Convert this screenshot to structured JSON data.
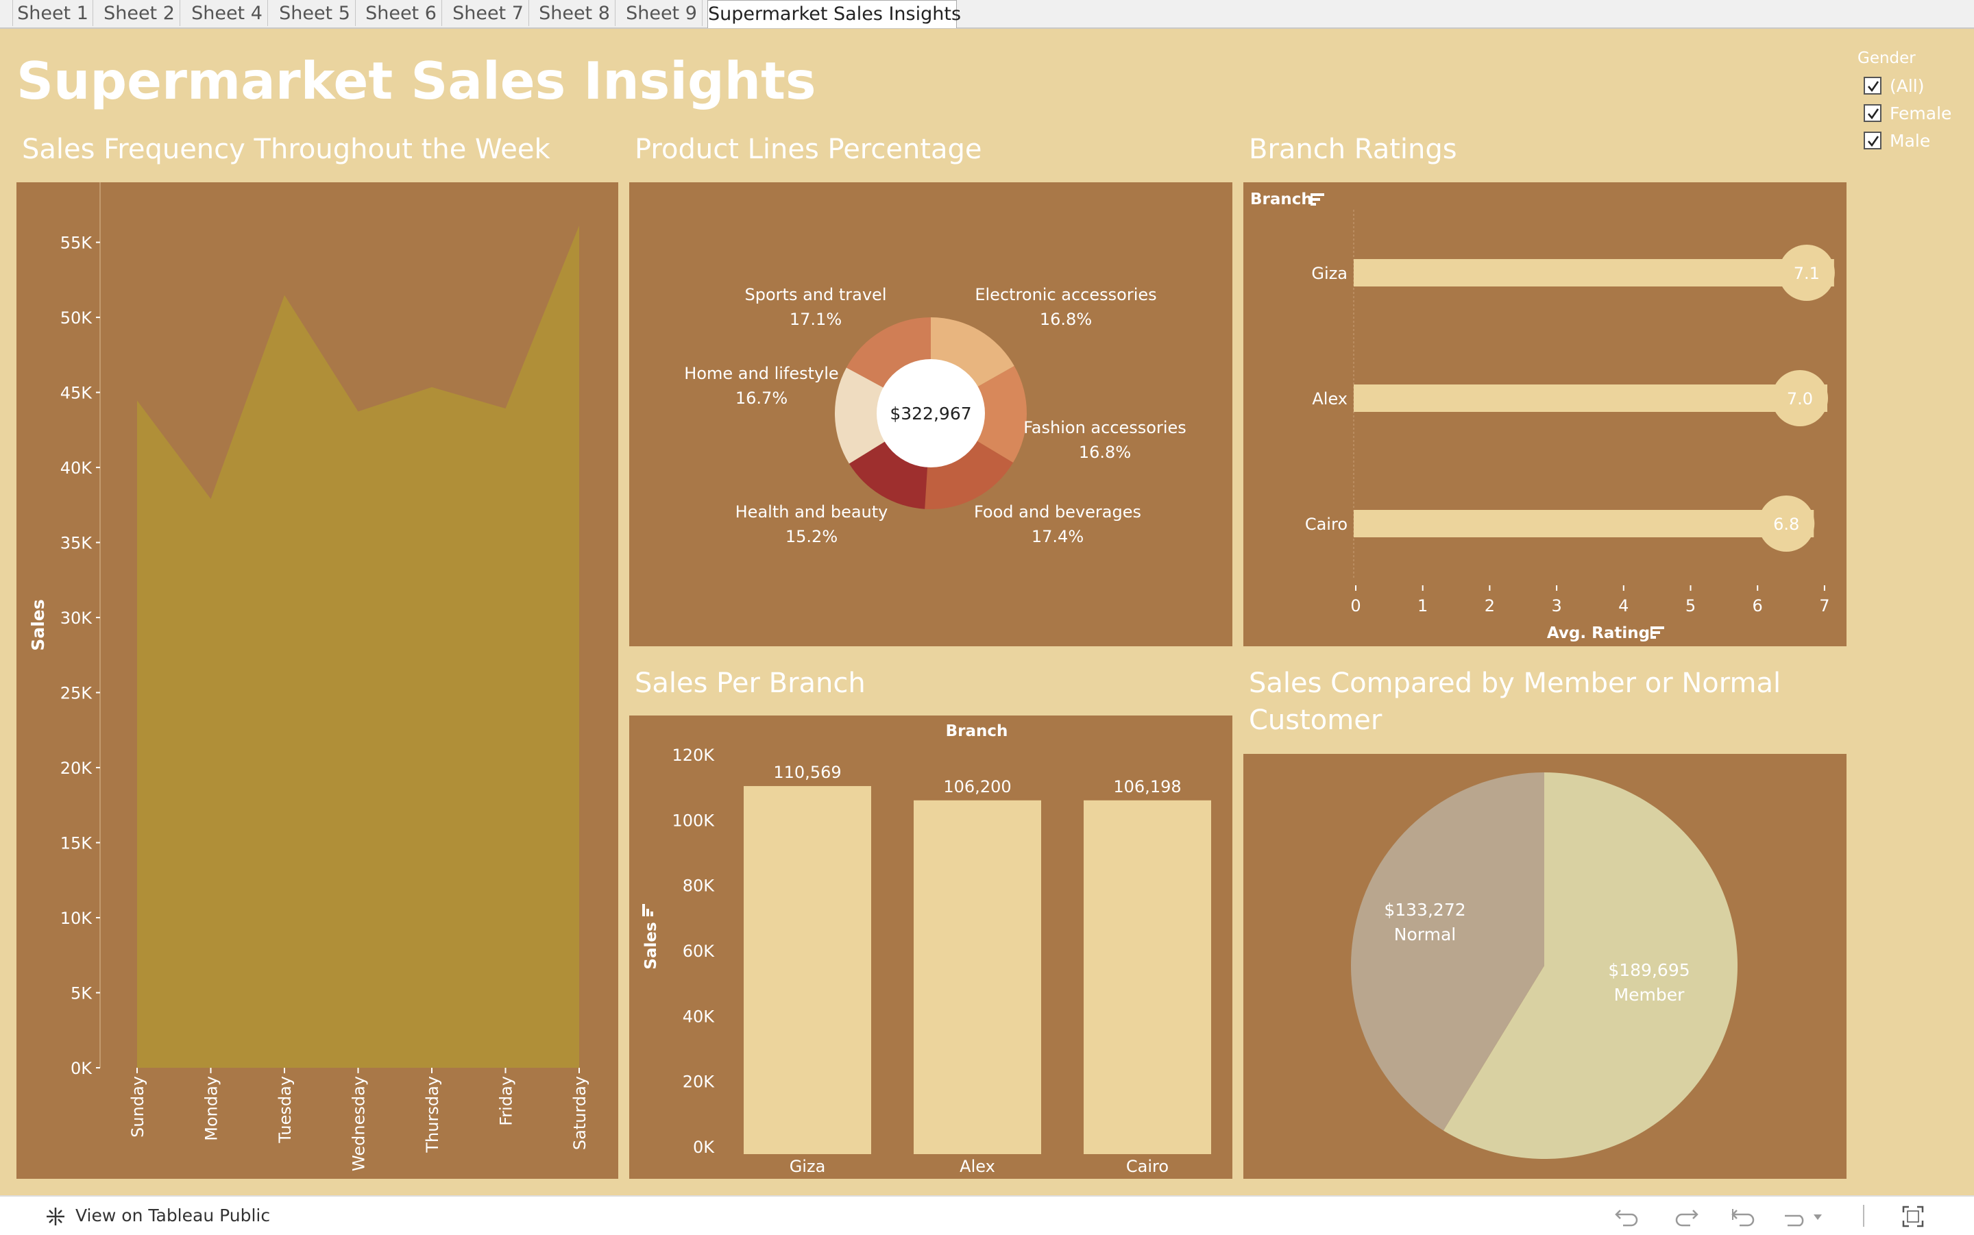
{
  "tabs": [
    "Sheet 1",
    "Sheet 2",
    "Sheet 4",
    "Sheet 5",
    "Sheet 6",
    "Sheet 7",
    "Sheet 8",
    "Sheet 9",
    "Supermarket Sales Insights"
  ],
  "dashboard": {
    "title": "Supermarket Sales Insights",
    "colors": {
      "background": "#ead49f",
      "panel": "#a97848",
      "area": "#b08f38",
      "bar": "#ecd49c"
    }
  },
  "filter": {
    "title": "Gender",
    "options": [
      {
        "label": "(All)",
        "checked": true
      },
      {
        "label": "Female",
        "checked": true
      },
      {
        "label": "Male",
        "checked": true
      }
    ]
  },
  "week_chart": {
    "title": "Sales Frequency Throughout the Week",
    "ylabel": "Sales",
    "yticks": [
      "0K",
      "5K",
      "10K",
      "15K",
      "20K",
      "25K",
      "30K",
      "35K",
      "40K",
      "45K",
      "50K",
      "55K"
    ],
    "days": [
      "Sunday",
      "Monday",
      "Tuesday",
      "Wednesday",
      "Thursday",
      "Friday",
      "Saturday"
    ]
  },
  "product_chart": {
    "title": "Product Lines Percentage",
    "center_label": "$322,967",
    "slices": [
      {
        "name": "Electronic accessories",
        "pct": "16.8%",
        "color": "#e8b57f"
      },
      {
        "name": "Fashion accessories",
        "pct": "16.8%",
        "color": "#d8885a"
      },
      {
        "name": "Food and beverages",
        "pct": "17.4%",
        "color": "#c0603f"
      },
      {
        "name": "Health and beauty",
        "pct": "15.2%",
        "color": "#9e2f2e"
      },
      {
        "name": "Home and lifestyle",
        "pct": "16.7%",
        "color": "#efdcc0"
      },
      {
        "name": "Sports and travel",
        "pct": "17.1%",
        "color": "#d07e55"
      }
    ]
  },
  "rating_chart": {
    "title": "Branch Ratings",
    "col_header": "Branch",
    "xlabel": "Avg. Rating",
    "xticks": [
      "0",
      "1",
      "2",
      "3",
      "4",
      "5",
      "6",
      "7"
    ],
    "branches": [
      {
        "name": "Giza",
        "label": "7.1"
      },
      {
        "name": "Alex",
        "label": "7.0"
      },
      {
        "name": "Cairo",
        "label": "6.8"
      }
    ]
  },
  "branch_sales": {
    "title": "Sales Per Branch",
    "col_header": "Branch",
    "ylabel": "Sales",
    "yticks": [
      "0K",
      "20K",
      "40K",
      "60K",
      "80K",
      "100K",
      "120K"
    ],
    "bars": [
      {
        "name": "Giza",
        "label": "110,569"
      },
      {
        "name": "Alex",
        "label": "106,200"
      },
      {
        "name": "Cairo",
        "label": "106,198"
      }
    ]
  },
  "member_chart": {
    "title_line1": "Sales Compared by Member or Normal",
    "title_line2": "Customer",
    "slices": [
      {
        "amount": "$189,695",
        "type": "Member",
        "color": "#d9d1a2"
      },
      {
        "amount": "$133,272",
        "type": "Normal",
        "color": "#b9a68e"
      }
    ]
  },
  "footer": {
    "link": "View on Tableau Public"
  },
  "chart_data": [
    {
      "type": "area",
      "title": "Sales Frequency Throughout the Week",
      "xlabel": "",
      "ylabel": "Sales",
      "categories": [
        "Sunday",
        "Monday",
        "Tuesday",
        "Wednesday",
        "Thursday",
        "Friday",
        "Saturday"
      ],
      "values": [
        44460,
        37900,
        51480,
        43730,
        45350,
        43930,
        56120
      ],
      "ylim": [
        0,
        59000
      ]
    },
    {
      "type": "pie",
      "title": "Product Lines Percentage",
      "categories": [
        "Electronic accessories",
        "Fashion accessories",
        "Food and beverages",
        "Health and beauty",
        "Home and lifestyle",
        "Sports and travel"
      ],
      "values": [
        16.8,
        16.8,
        17.4,
        15.2,
        16.7,
        17.1
      ]
    },
    {
      "type": "bar",
      "title": "Branch Ratings",
      "xlabel": "Avg. Rating",
      "categories": [
        "Giza",
        "Alex",
        "Cairo"
      ],
      "values": [
        7.1,
        7.0,
        6.8
      ],
      "xlim": [
        0,
        7
      ]
    },
    {
      "type": "bar",
      "title": "Sales Per Branch",
      "ylabel": "Sales",
      "categories": [
        "Giza",
        "Alex",
        "Cairo"
      ],
      "values": [
        110569,
        106200,
        106198
      ],
      "ylim": [
        0,
        120000
      ]
    },
    {
      "type": "pie",
      "title": "Sales Compared by Member or Normal Customer",
      "categories": [
        "Member",
        "Normal"
      ],
      "values": [
        189695,
        133272
      ]
    }
  ]
}
